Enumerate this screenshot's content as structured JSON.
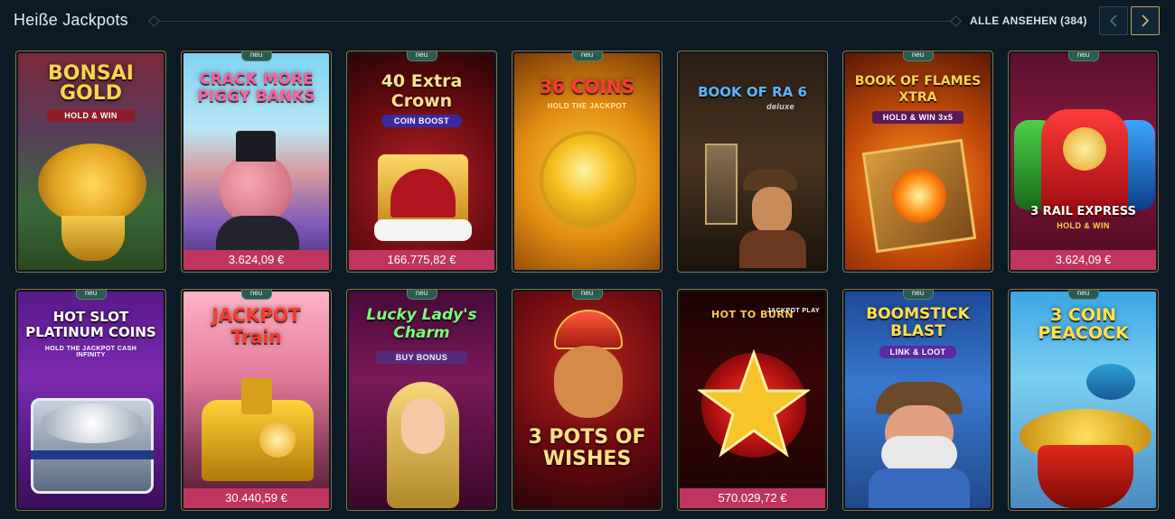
{
  "header": {
    "title": "Heiße Jackpots",
    "view_all_label": "ALLE ANSEHEN (384)"
  },
  "games": [
    {
      "title": "BONSAI GOLD",
      "subtitle": "HOLD & WIN",
      "badge": "",
      "jackpot": ""
    },
    {
      "title": "CRACK MORE PIGGY BANKS",
      "subtitle": "",
      "badge": "neu",
      "jackpot": "3.624,09 €"
    },
    {
      "title": "40 Extra Crown",
      "subtitle": "COIN BOOST",
      "badge": "neu",
      "jackpot": "166.775,82 €"
    },
    {
      "title": "36 COINS",
      "subtitle": "HOLD THE JACKPOT",
      "badge": "neu",
      "jackpot": ""
    },
    {
      "title": "BOOK OF RA 6",
      "subtitle": "deluxe",
      "badge": "",
      "jackpot": ""
    },
    {
      "title": "BOOK OF FLAMES XTRA",
      "subtitle": "HOLD & WIN 3x5",
      "badge": "neu",
      "jackpot": ""
    },
    {
      "title": "3 RAIL EXPRESS",
      "subtitle": "HOLD & WIN",
      "badge": "neu",
      "jackpot": "3.624,09 €"
    },
    {
      "title": "HOT SLOT PLATINUM COINS",
      "subtitle": "HOLD THE JACKPOT CASH INFINITY",
      "badge": "neu",
      "jackpot": ""
    },
    {
      "title": "JACKPOT Train",
      "subtitle": "",
      "badge": "neu",
      "jackpot": "30.440,59 €"
    },
    {
      "title": "Lucky Lady's Charm",
      "subtitle": "BUY BONUS",
      "badge": "neu",
      "jackpot": ""
    },
    {
      "title": "3 POTS OF WISHES",
      "subtitle": "",
      "badge": "neu",
      "jackpot": ""
    },
    {
      "title": "HOT TO BURN",
      "subtitle": "JACKPOT PLAY",
      "badge": "",
      "jackpot": "570.029,72 €"
    },
    {
      "title": "BOOMSTICK BLAST",
      "subtitle": "LINK & LOOT",
      "badge": "neu",
      "jackpot": ""
    },
    {
      "title": "3 COIN PEACOCK",
      "subtitle": "",
      "badge": "neu",
      "jackpot": ""
    }
  ],
  "colors": {
    "background": "#0b1a24",
    "jackpot_bar": "#c0355f",
    "badge_new": "#2c5a4e",
    "card_border": "#8a7444",
    "nav_active_border": "#c8a55a"
  },
  "icons": {
    "prev": "chevron-left-icon",
    "next": "chevron-right-icon"
  }
}
